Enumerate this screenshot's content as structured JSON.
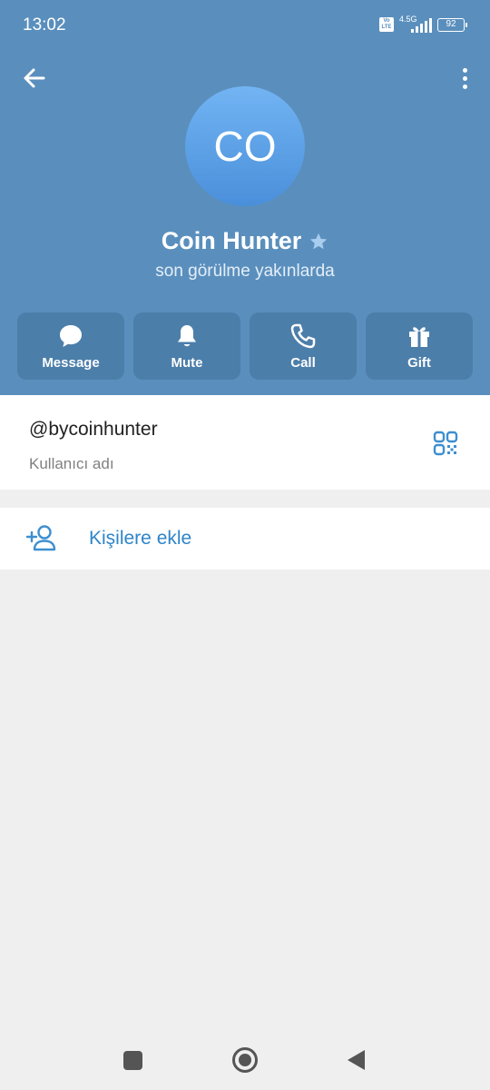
{
  "status_bar": {
    "time": "13:02",
    "volte": "Vo LTE",
    "network": "4.5G",
    "battery": "92"
  },
  "profile": {
    "avatar_initials": "CO",
    "name": "Coin Hunter",
    "status": "son görülme yakınlarda"
  },
  "actions": [
    {
      "label": "Message",
      "icon": "message-icon"
    },
    {
      "label": "Mute",
      "icon": "bell-icon"
    },
    {
      "label": "Call",
      "icon": "phone-icon"
    },
    {
      "label": "Gift",
      "icon": "gift-icon"
    }
  ],
  "info": {
    "username": "@bycoinhunter",
    "username_caption": "Kullanıcı adı"
  },
  "add_contact": {
    "label": "Kişilere ekle"
  },
  "colors": {
    "header": "#5a8fbd",
    "action_bg": "#4c7eaa",
    "accent": "#2f85c8",
    "background": "#efefef"
  }
}
